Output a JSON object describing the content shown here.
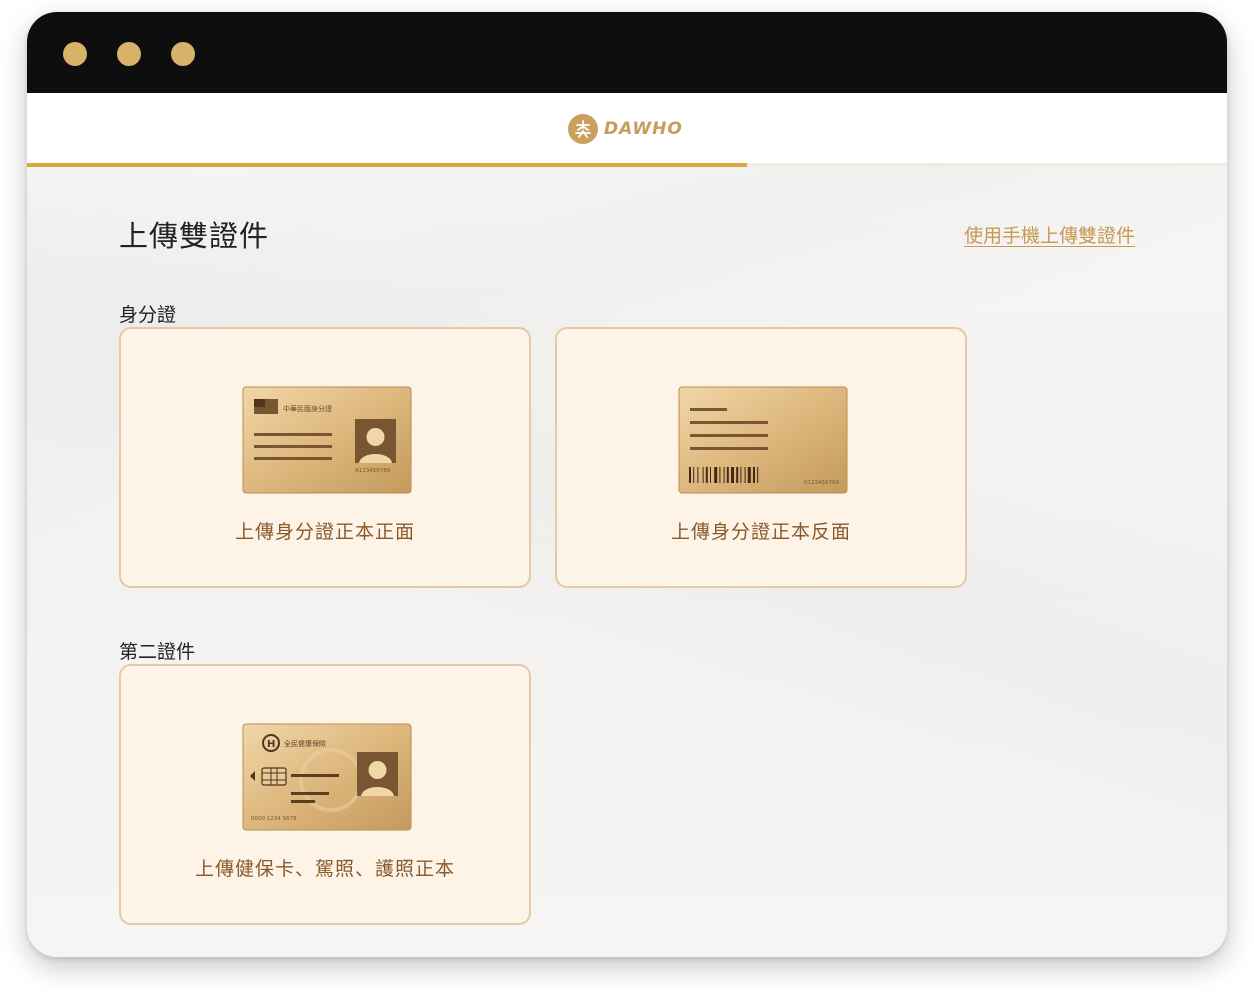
{
  "window": {
    "traffic_lights": [
      "close",
      "minimize",
      "maximize"
    ],
    "accent": "#d9b26a"
  },
  "header": {
    "logo_text": "DAWHO",
    "logo_color": "#c59e5e",
    "progress_fraction": 0.6
  },
  "main": {
    "title": "上傳雙證件",
    "mobile_link": "使用手機上傳雙證件",
    "sections": [
      {
        "title": "身分證",
        "cards": [
          {
            "label": "上傳身分證正本正面",
            "icon": "id-card-front-icon",
            "card_header": "中華民國身分證",
            "card_number": "A123456789"
          },
          {
            "label": "上傳身分證正本反面",
            "icon": "id-card-back-icon",
            "card_number": "0123456789"
          }
        ]
      },
      {
        "title": "第二證件",
        "cards": [
          {
            "label": "上傳健保卡、駕照、護照正本",
            "icon": "health-insurance-card-icon",
            "card_header": "全民健康保險",
            "card_number": "0000 1234 5678"
          }
        ]
      }
    ]
  },
  "colors": {
    "card_bg": "#fdf3e7",
    "card_border": "#e3c9a6",
    "card_label": "#8a5a2b",
    "gold": "#d8a93a",
    "link": "#c79a52"
  }
}
